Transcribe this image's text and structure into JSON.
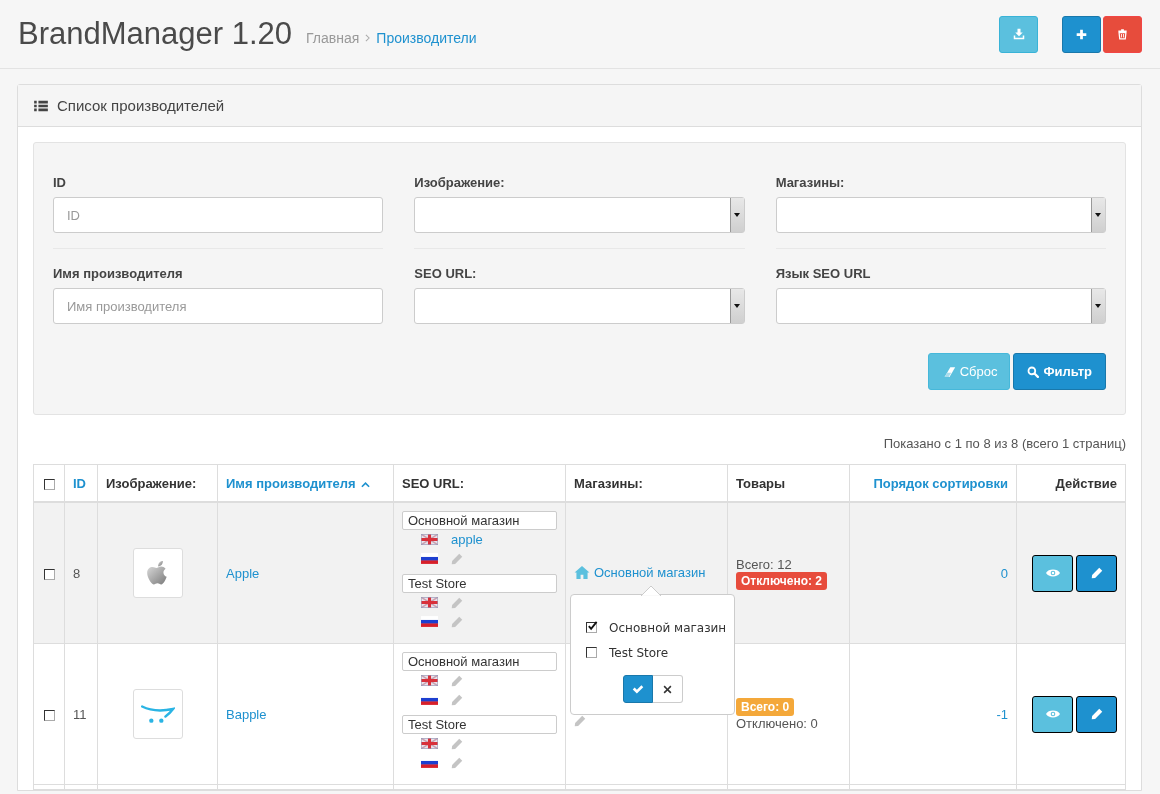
{
  "header": {
    "title": "BrandManager 1.20",
    "breadcrumbs": [
      {
        "label": "Главная",
        "kind": "muted"
      },
      {
        "label": "Производители",
        "kind": "link"
      }
    ],
    "buttons": [
      {
        "kind": "download"
      },
      {
        "kind": "add"
      },
      {
        "kind": "delete"
      }
    ]
  },
  "panel": {
    "title": "Список производителей"
  },
  "filter": {
    "fields": [
      {
        "label": "ID",
        "kind": "text",
        "placeholder": "ID"
      },
      {
        "label": "Изображение:",
        "kind": "select"
      },
      {
        "label": "Магазины:",
        "kind": "select"
      },
      {
        "label": "Имя производителя",
        "kind": "text",
        "placeholder": "Имя производителя"
      },
      {
        "label": "SEO URL:",
        "kind": "select"
      },
      {
        "label": "Язык SEO URL",
        "kind": "select"
      }
    ],
    "buttons": [
      {
        "label": "Сброс",
        "kind": "reset"
      },
      {
        "label": "Фильтр",
        "kind": "filter"
      }
    ]
  },
  "pagination_text": "Показано с 1 по 8 из 8 (всего 1 страниц)",
  "table": {
    "select_all": {
      "checked": false
    },
    "columns": [
      {
        "label": "ID",
        "sortable": true,
        "sorted_ascending": false
      },
      {
        "label": "Изображение:",
        "sortable": false,
        "sorted_ascending": false
      },
      {
        "label": "Имя производителя",
        "sortable": true,
        "sorted_ascending": true
      },
      {
        "label": "SEO URL:",
        "sortable": false,
        "sorted_ascending": false
      },
      {
        "label": "Магазины:",
        "sortable": false,
        "sorted_ascending": false
      },
      {
        "label": "Товары",
        "sortable": false,
        "sorted_ascending": false
      },
      {
        "label": "Порядок сортировки",
        "sortable": true,
        "sorted_ascending": false
      },
      {
        "label": "Действие",
        "sortable": false,
        "sorted_ascending": false
      }
    ],
    "rows": [
      {
        "checked": false,
        "hovered": true,
        "id": "8",
        "name": "Apple",
        "seo": [
          {
            "store": "Основной магазин",
            "entries": [
              {
                "kind": "link",
                "value": "apple"
              },
              {
                "kind": "edit"
              }
            ]
          },
          {
            "store": "Test Store",
            "entries": [
              {
                "kind": "edit"
              },
              {
                "kind": "edit"
              }
            ]
          }
        ],
        "stores": {
          "kind": "link",
          "label": "Основной магазин"
        },
        "products": [
          {
            "text": "Всего: 12",
            "kind": "plain"
          },
          {
            "text": "Отключено: 2",
            "kind": "danger"
          }
        ],
        "sort_order": "0"
      },
      {
        "checked": false,
        "hovered": false,
        "id": "11",
        "name": "Bapple",
        "seo": [
          {
            "store": "Основной магазин",
            "entries": [
              {
                "kind": "edit"
              },
              {
                "kind": "edit"
              }
            ]
          },
          {
            "store": "Test Store",
            "entries": [
              {
                "kind": "edit"
              },
              {
                "kind": "edit"
              }
            ]
          }
        ],
        "stores": {
          "kind": "edit"
        },
        "products": [
          {
            "text": "Всего: 0",
            "kind": "warning"
          },
          {
            "text": "Отключено: 0",
            "kind": "plain"
          }
        ],
        "sort_order": "-1"
      }
    ]
  },
  "popover": {
    "items": [
      {
        "label": "Основной магазин",
        "checked": true
      },
      {
        "label": "Test Store",
        "checked": false
      }
    ]
  }
}
